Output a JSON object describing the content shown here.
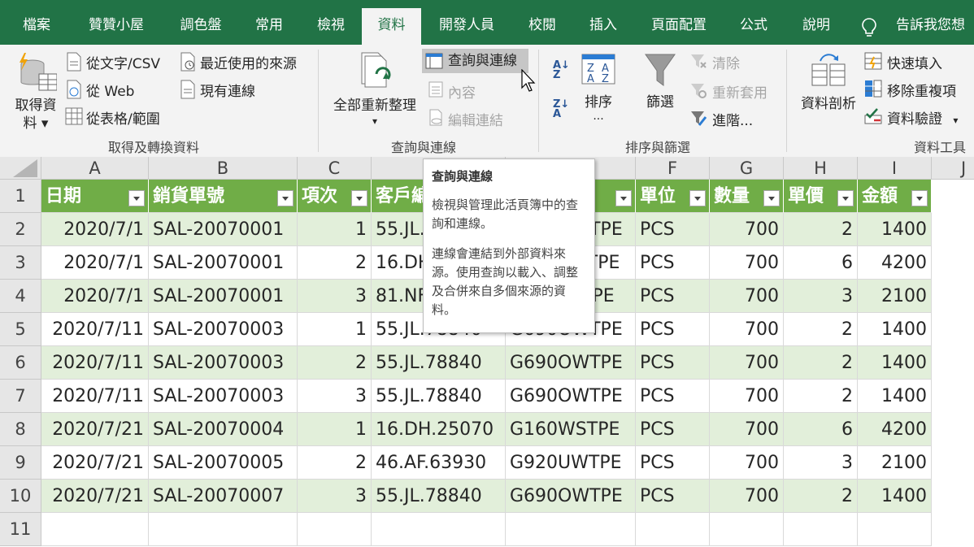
{
  "tabs": [
    "檔案",
    "贊贊小屋",
    "調色盤",
    "常用",
    "檢視",
    "資料",
    "開發人員",
    "校閱",
    "插入",
    "頁面配置",
    "公式",
    "說明"
  ],
  "tell_me": "告訴我您想",
  "ribbon": {
    "get_data": "取得資",
    "get_data2": "料",
    "from_text": "從文字/CSV",
    "from_web": "從 Web",
    "from_table": "從表格/範圍",
    "recent_sources": "最近使用的來源",
    "existing_conn": "現有連線",
    "group_get": "取得及轉換資料",
    "refresh_all": "全部重新整理",
    "queries_conn": "查詢與連線",
    "properties": "內容",
    "edit_links": "編輯連結",
    "group_queries": "查詢與連線",
    "sort": "排序",
    "sort_more": "...",
    "filter": "篩選",
    "clear": "清除",
    "reapply": "重新套用",
    "advanced": "進階...",
    "group_sort": "排序與篩選",
    "text_to_cols": "資料剖析",
    "flash_fill": "快速填入",
    "remove_dup": "移除重複項",
    "data_valid": "資料驗證",
    "group_tools": "資料工具"
  },
  "tooltip": {
    "title": "查詢與連線",
    "p1": "檢視與管理此活頁簿中的查詢和連線。",
    "p2": "連線會連結到外部資料來源。使用查詢以載入、調整及合併來自多個來源的資料。"
  },
  "columns": [
    "A",
    "B",
    "C",
    "D",
    "E",
    "F",
    "G",
    "H",
    "I",
    "J"
  ],
  "rows": [
    "1",
    "2",
    "3",
    "4",
    "5",
    "6",
    "7",
    "8",
    "9",
    "10",
    "11"
  ],
  "table": {
    "headers": [
      "日期",
      "銷貨單號",
      "項次",
      "客戶編號",
      "",
      "單位",
      "數量",
      "單價",
      "金額"
    ],
    "data": [
      [
        "2020/7/1",
        "SAL-20070001",
        "1",
        "55.JL.78840",
        "G690OWTPE",
        "PCS",
        "700",
        "2",
        "1400"
      ],
      [
        "2020/7/1",
        "SAL-20070001",
        "2",
        "16.DH.25070",
        "G160WSTPE",
        "PCS",
        "700",
        "6",
        "4200"
      ],
      [
        "2020/7/1",
        "SAL-20070001",
        "3",
        "81.NF.08770",
        "G800ZSTPE",
        "PCS",
        "700",
        "3",
        "2100"
      ],
      [
        "2020/7/11",
        "SAL-20070003",
        "1",
        "55.JL.78840",
        "G690OWTPE",
        "PCS",
        "700",
        "2",
        "1400"
      ],
      [
        "2020/7/11",
        "SAL-20070003",
        "2",
        "55.JL.78840",
        "G690OWTPE",
        "PCS",
        "700",
        "2",
        "1400"
      ],
      [
        "2020/7/11",
        "SAL-20070003",
        "3",
        "55.JL.78840",
        "G690OWTPE",
        "PCS",
        "700",
        "2",
        "1400"
      ],
      [
        "2020/7/21",
        "SAL-20070004",
        "1",
        "16.DH.25070",
        "G160WSTPE",
        "PCS",
        "700",
        "6",
        "4200"
      ],
      [
        "2020/7/21",
        "SAL-20070005",
        "2",
        "46.AF.63930",
        "G920UWTPE",
        "PCS",
        "700",
        "3",
        "2100"
      ],
      [
        "2020/7/21",
        "SAL-20070007",
        "3",
        "55.JL.78840",
        "G690OWTPE",
        "PCS",
        "700",
        "2",
        "1400"
      ]
    ]
  },
  "colors": {
    "accent": "#217346",
    "table_header": "#70ad47",
    "band": "#e2efda"
  }
}
